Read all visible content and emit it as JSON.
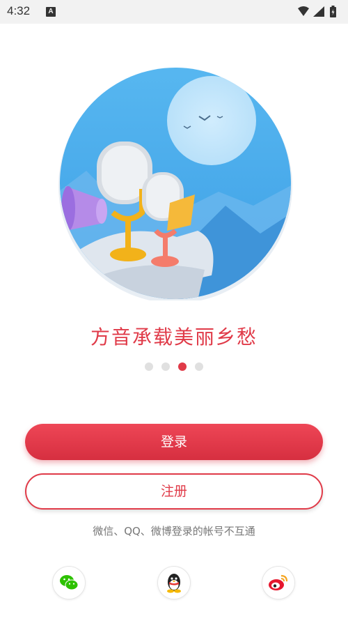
{
  "status_bar": {
    "time": "4:32",
    "notification_icon": "a-letter-icon",
    "letter": "A",
    "indicators": [
      "wifi-icon",
      "signal-icon",
      "battery-icon"
    ]
  },
  "onboarding": {
    "slogan": "方音承载美丽乡愁",
    "illustration": "microphones-singing-moon-illustration",
    "page_indicator": {
      "total": 4,
      "active": 3
    }
  },
  "actions": {
    "login_label": "登录",
    "register_label": "注册"
  },
  "social_login": {
    "notice": "微信、QQ、微博登录的帐号不互通",
    "providers": [
      "wechat-icon",
      "qq-icon",
      "weibo-icon"
    ]
  },
  "colors": {
    "accent": "#e03a48",
    "sky": "#4aa8e8"
  }
}
